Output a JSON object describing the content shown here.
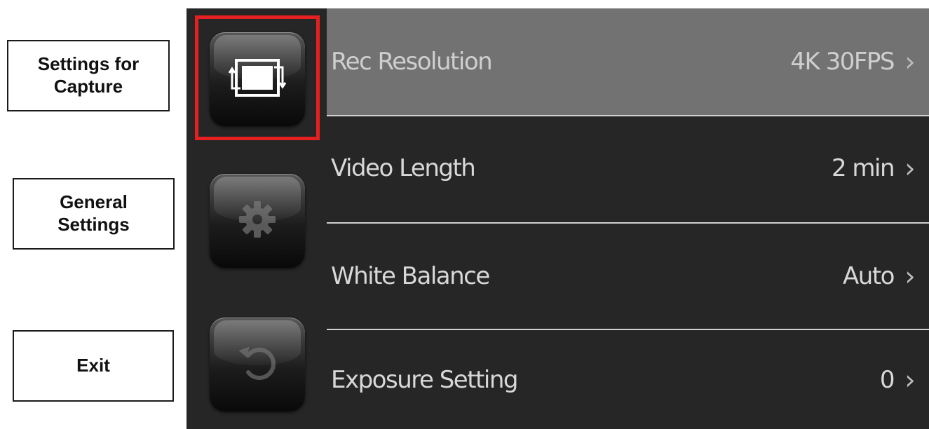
{
  "callouts": {
    "capture": [
      "Settings for",
      "Capture"
    ],
    "general": [
      "General",
      "Settings"
    ],
    "exit": "Exit"
  },
  "sidebar": {
    "items": [
      {
        "icon": "video-camera-icon",
        "state": "selected"
      },
      {
        "icon": "gear-icon",
        "state": "inactive"
      },
      {
        "icon": "back-arrow-icon",
        "state": "inactive"
      }
    ]
  },
  "menu": {
    "rows": [
      {
        "label": "Rec Resolution",
        "value": "4K 30FPS",
        "selected": true
      },
      {
        "label": "Video Length",
        "value": "2 min",
        "selected": false
      },
      {
        "label": "White Balance",
        "value": "Auto",
        "selected": false
      },
      {
        "label": "Exposure Setting",
        "value": "0",
        "selected": false
      }
    ],
    "chevron": "›"
  },
  "colors": {
    "screen_bg": "#262626",
    "selected_row_bg": "#727272",
    "highlight_border": "#e52020",
    "text": "#d8d8d8"
  }
}
